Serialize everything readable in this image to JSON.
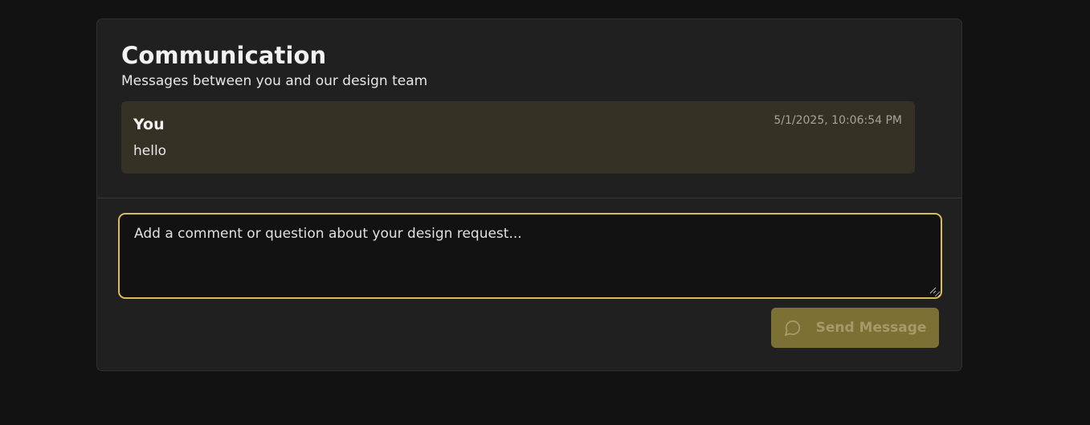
{
  "communication": {
    "title": "Communication",
    "subtitle": "Messages between you and our design team"
  },
  "messages": [
    {
      "author": "You",
      "timestamp": "5/1/2025, 10:06:54 PM",
      "body": "hello"
    }
  ],
  "composer": {
    "placeholder": "Add a comment or question about your design request...",
    "value": "",
    "send_label": "Send Message",
    "send_icon": "message-circle-icon"
  },
  "colors": {
    "background": "#121212",
    "card": "#202020",
    "message_bubble": "#353124",
    "accent": "#d9bc55",
    "send_button": "#7d7035"
  }
}
